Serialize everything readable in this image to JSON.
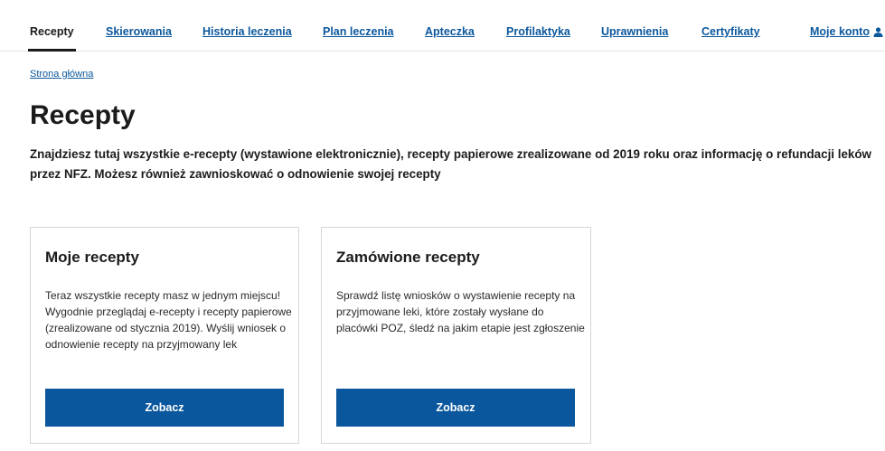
{
  "nav": {
    "items": [
      {
        "label": "Recepty"
      },
      {
        "label": "Skierowania"
      },
      {
        "label": "Historia leczenia"
      },
      {
        "label": "Plan leczenia"
      },
      {
        "label": "Apteczka"
      },
      {
        "label": "Profilaktyka"
      },
      {
        "label": "Uprawnienia"
      },
      {
        "label": "Certyfikaty"
      }
    ],
    "account_label": "Moje konto",
    "account_icon": "person-icon"
  },
  "breadcrumb": "Strona główna",
  "page_title": "Recepty",
  "intro": "Znajdziesz tutaj wszystkie e-recepty (wystawione elektronicznie), recepty papierowe zrealizowane od 2019 roku oraz informację o refundacji leków przez NFZ. Możesz również zawnioskować o odnowienie swojej recepty",
  "cards": [
    {
      "title": "Moje recepty",
      "description": "Teraz wszystkie recepty masz w jednym miejscu! Wygodnie przeglądaj e-recepty i recepty papierowe (zrealizowane od stycznia 2019). Wyślij wniosek o odnowienie recepty na przyjmowany lek",
      "button": "Zobacz"
    },
    {
      "title": "Zamówione recepty",
      "description": "Sprawdź listę wniosków o wystawienie recepty na przyjmowane leki, które zostały wysłane do placówki POZ, śledź na jakim etapie jest zgłoszenie",
      "button": "Zobacz"
    }
  ],
  "colors": {
    "link": "#0b579d",
    "primary_button": "#0b579d",
    "text": "#1b1b1b"
  }
}
